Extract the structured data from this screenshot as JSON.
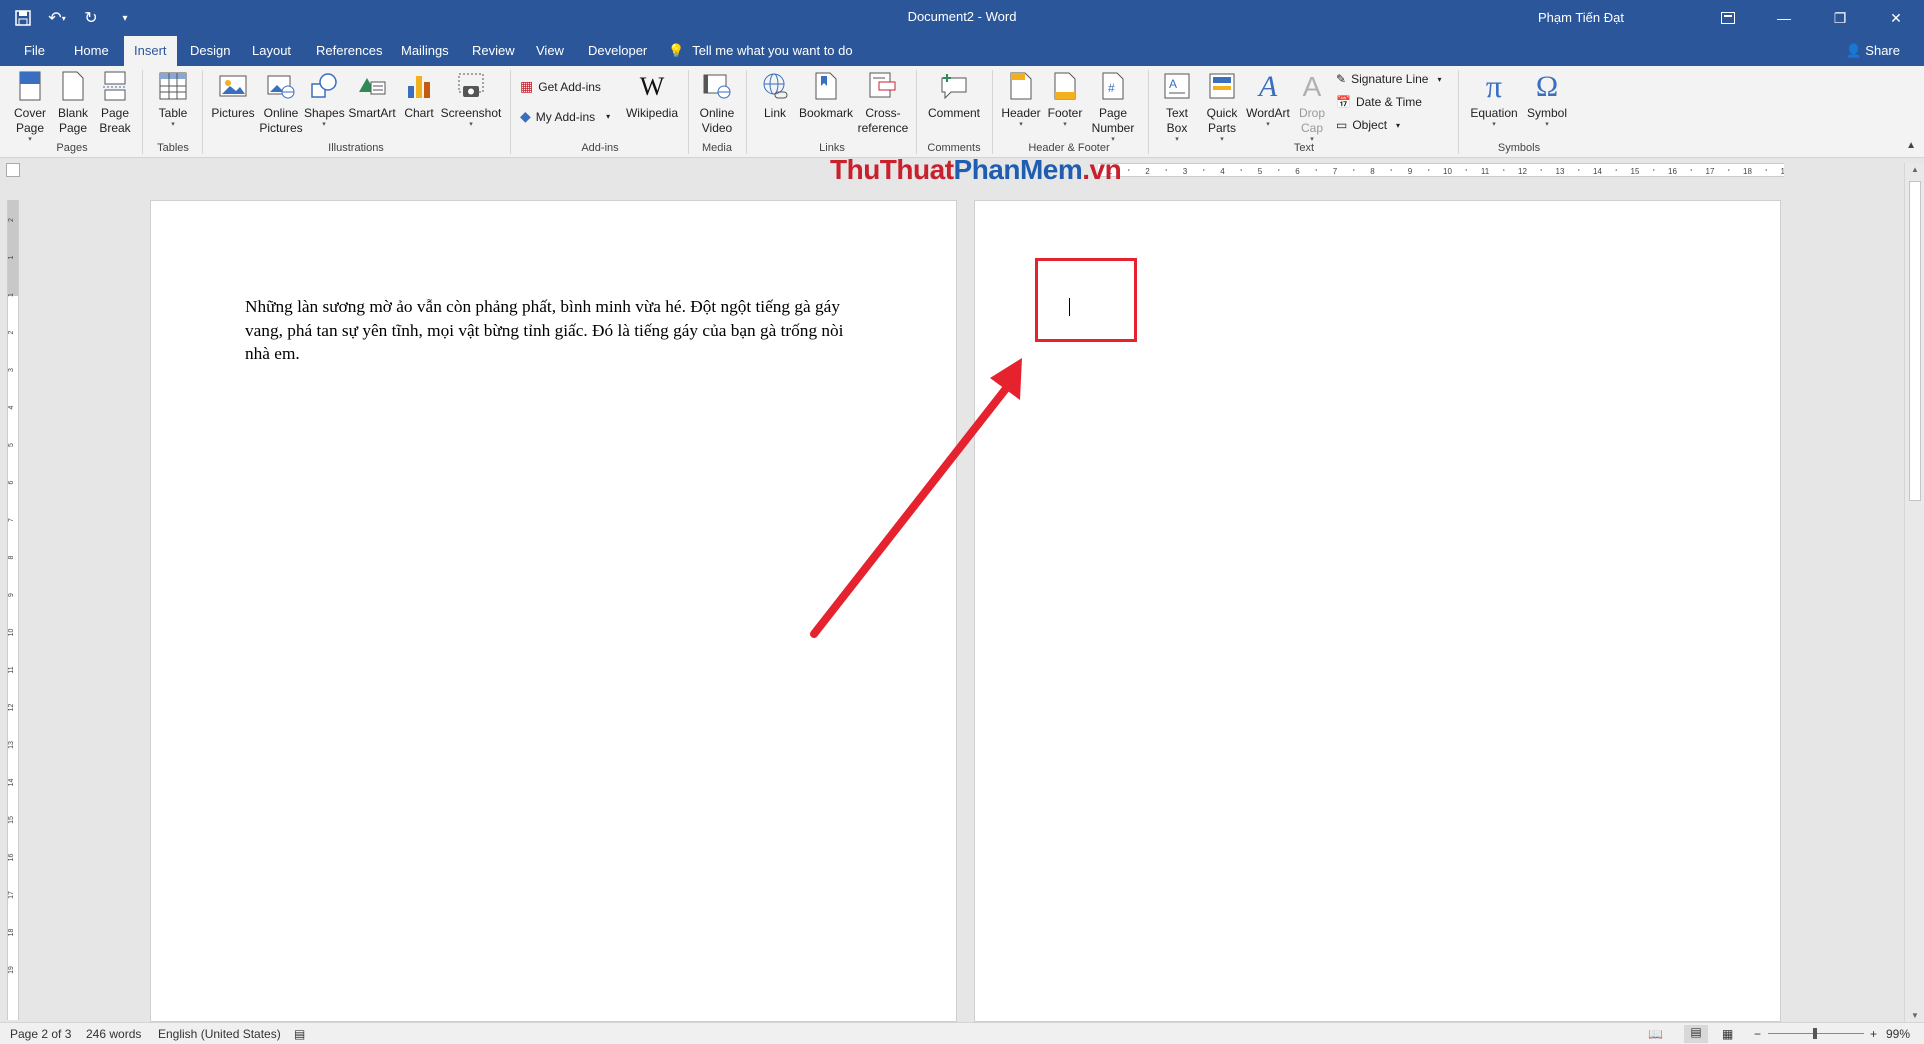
{
  "app": {
    "document_title": "Document2 - Word",
    "user_name": "Phạm Tiến Đạt"
  },
  "tabs": [
    {
      "label": "File"
    },
    {
      "label": "Home"
    },
    {
      "label": "Insert"
    },
    {
      "label": "Design"
    },
    {
      "label": "Layout"
    },
    {
      "label": "References"
    },
    {
      "label": "Mailings"
    },
    {
      "label": "Review"
    },
    {
      "label": "View"
    },
    {
      "label": "Developer"
    }
  ],
  "tell_me": "Tell me what you want to do",
  "share_label": "Share",
  "ribbon": {
    "pages": {
      "cover_page": "Cover\nPage",
      "blank_page": "Blank\nPage",
      "page_break": "Page\nBreak",
      "group": "Pages"
    },
    "tables": {
      "table": "Table",
      "group": "Tables"
    },
    "illustrations": {
      "pictures": "Pictures",
      "online_pictures": "Online\nPictures",
      "shapes": "Shapes",
      "smartart": "SmartArt",
      "chart": "Chart",
      "screenshot": "Screenshot",
      "group": "Illustrations"
    },
    "addins": {
      "get_addins": "Get Add-ins",
      "my_addins": "My Add-ins",
      "wikipedia": "Wikipedia",
      "group": "Add-ins"
    },
    "media": {
      "online_video": "Online\nVideo",
      "group": "Media"
    },
    "links": {
      "link": "Link",
      "bookmark": "Bookmark",
      "cross_reference": "Cross-\nreference",
      "group": "Links"
    },
    "comments": {
      "comment": "Comment",
      "group": "Comments"
    },
    "header_footer": {
      "header": "Header",
      "footer": "Footer",
      "page_number": "Page\nNumber",
      "group": "Header & Footer"
    },
    "text": {
      "text_box": "Text\nBox",
      "quick_parts": "Quick\nParts",
      "wordart": "WordArt",
      "drop_cap": "Drop\nCap",
      "signature_line": "Signature Line",
      "date_time": "Date & Time",
      "object": "Object",
      "group": "Text"
    },
    "symbols": {
      "equation": "Equation",
      "symbol": "Symbol",
      "group": "Symbols"
    }
  },
  "ruler_ticks": [
    "1",
    "2",
    "3",
    "4",
    "5",
    "6",
    "7",
    "8",
    "9",
    "10",
    "11",
    "12",
    "13",
    "14",
    "15",
    "16",
    "17",
    "18",
    "19"
  ],
  "vertical_ruler_ticks": [
    "2",
    "1",
    "1",
    "2",
    "3",
    "4",
    "5",
    "6",
    "7",
    "8",
    "9",
    "10",
    "11",
    "12",
    "13",
    "14",
    "15",
    "16",
    "17",
    "18",
    "19"
  ],
  "watermark": {
    "part1": "ThuThuat",
    "part2": "PhanMem",
    "part3": ".vn"
  },
  "document": {
    "page1_text": "Những làn sương mờ ảo vẫn còn phảng phất, bình minh vừa hé. Đột ngột tiếng gà gáy vang, phá tan sự yên tĩnh, mọi vật bừng tỉnh giấc. Đó là tiếng gáy của bạn gà trống nòi nhà em."
  },
  "status": {
    "page": "Page 2 of 3",
    "words": "246 words",
    "language": "English (United States)",
    "zoom": "99%",
    "zoom_level_percent": 99
  },
  "colors": {
    "accent": "#2b579a",
    "highlight": "#e5222e"
  }
}
